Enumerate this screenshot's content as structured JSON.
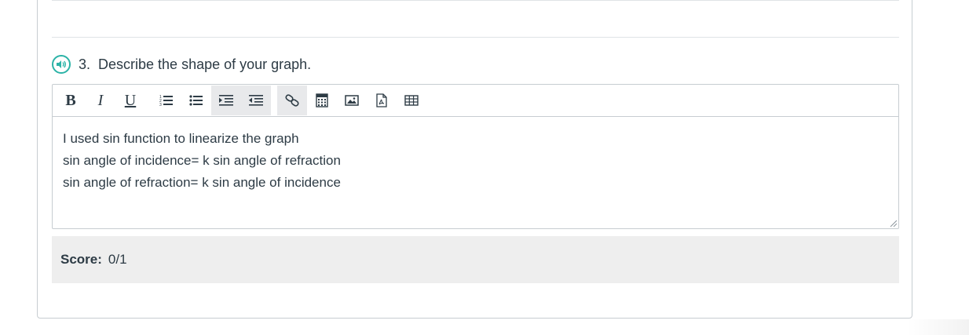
{
  "question": {
    "number": "3.",
    "text": "Describe the shape of your graph."
  },
  "toolbar": {
    "bold": "B",
    "italic": "I",
    "underline": "U"
  },
  "answer": {
    "lines": [
      "I used sin function to linearize the graph",
      "sin angle of incidence= k sin angle of refraction",
      "sin angle of refraction= k sin angle of incidence"
    ]
  },
  "score": {
    "label": "Score:",
    "value": "0/1"
  },
  "colors": {
    "accent": "#2bb3a7",
    "text": "#2d3b45",
    "border": "#c7cdd1",
    "score_bg": "#eeeeee"
  },
  "icons": [
    "audio-icon",
    "ordered-list-icon",
    "unordered-list-icon",
    "indent-icon",
    "outdent-icon",
    "link-icon",
    "calculator-icon",
    "image-icon",
    "pdf-icon",
    "table-icon"
  ]
}
